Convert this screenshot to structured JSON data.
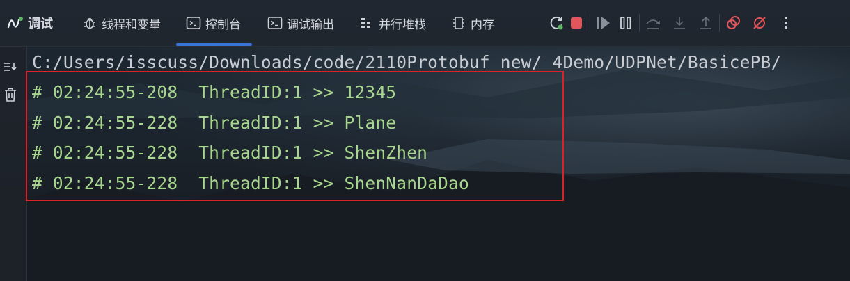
{
  "toolbar": {
    "debug_label": "调试",
    "tabs": [
      {
        "label": "线程和变量",
        "icon": "bug-icon"
      },
      {
        "label": "控制台",
        "icon": "terminal-icon",
        "active": true
      },
      {
        "label": "调试输出",
        "icon": "terminal-icon"
      },
      {
        "label": "并行堆栈",
        "icon": "parallel-stacks-icon"
      },
      {
        "label": "内存",
        "icon": "memory-chip-icon"
      }
    ],
    "controls": [
      "rerun-icon",
      "stop-icon",
      "resume-icon",
      "pause-icon",
      "step-over-icon",
      "step-into-icon",
      "step-out-icon",
      "breakpoints-icon",
      "mute-breakpoints-icon",
      "more-options-icon"
    ]
  },
  "gutter": [
    "soft-wrap-icon",
    "trash-icon"
  ],
  "console": {
    "path_line": "C:/Users/isscuss/Downloads/code/2110Protobuf new/_4Demo/UDPNet/BasicePB/",
    "lines": [
      "# 02:24:55-208  ThreadID:1 >> 12345",
      "# 02:24:55-228  ThreadID:1 >> Plane",
      "# 02:24:55-228  ThreadID:1 >> ShenZhen",
      "# 02:24:55-228  ThreadID:1 >> ShenNanDaDao"
    ]
  },
  "colors": {
    "accent": "#3b74d9",
    "stop": "#e0565b",
    "highlight_box": "#d9222a",
    "output_text": "#a9d68f"
  }
}
